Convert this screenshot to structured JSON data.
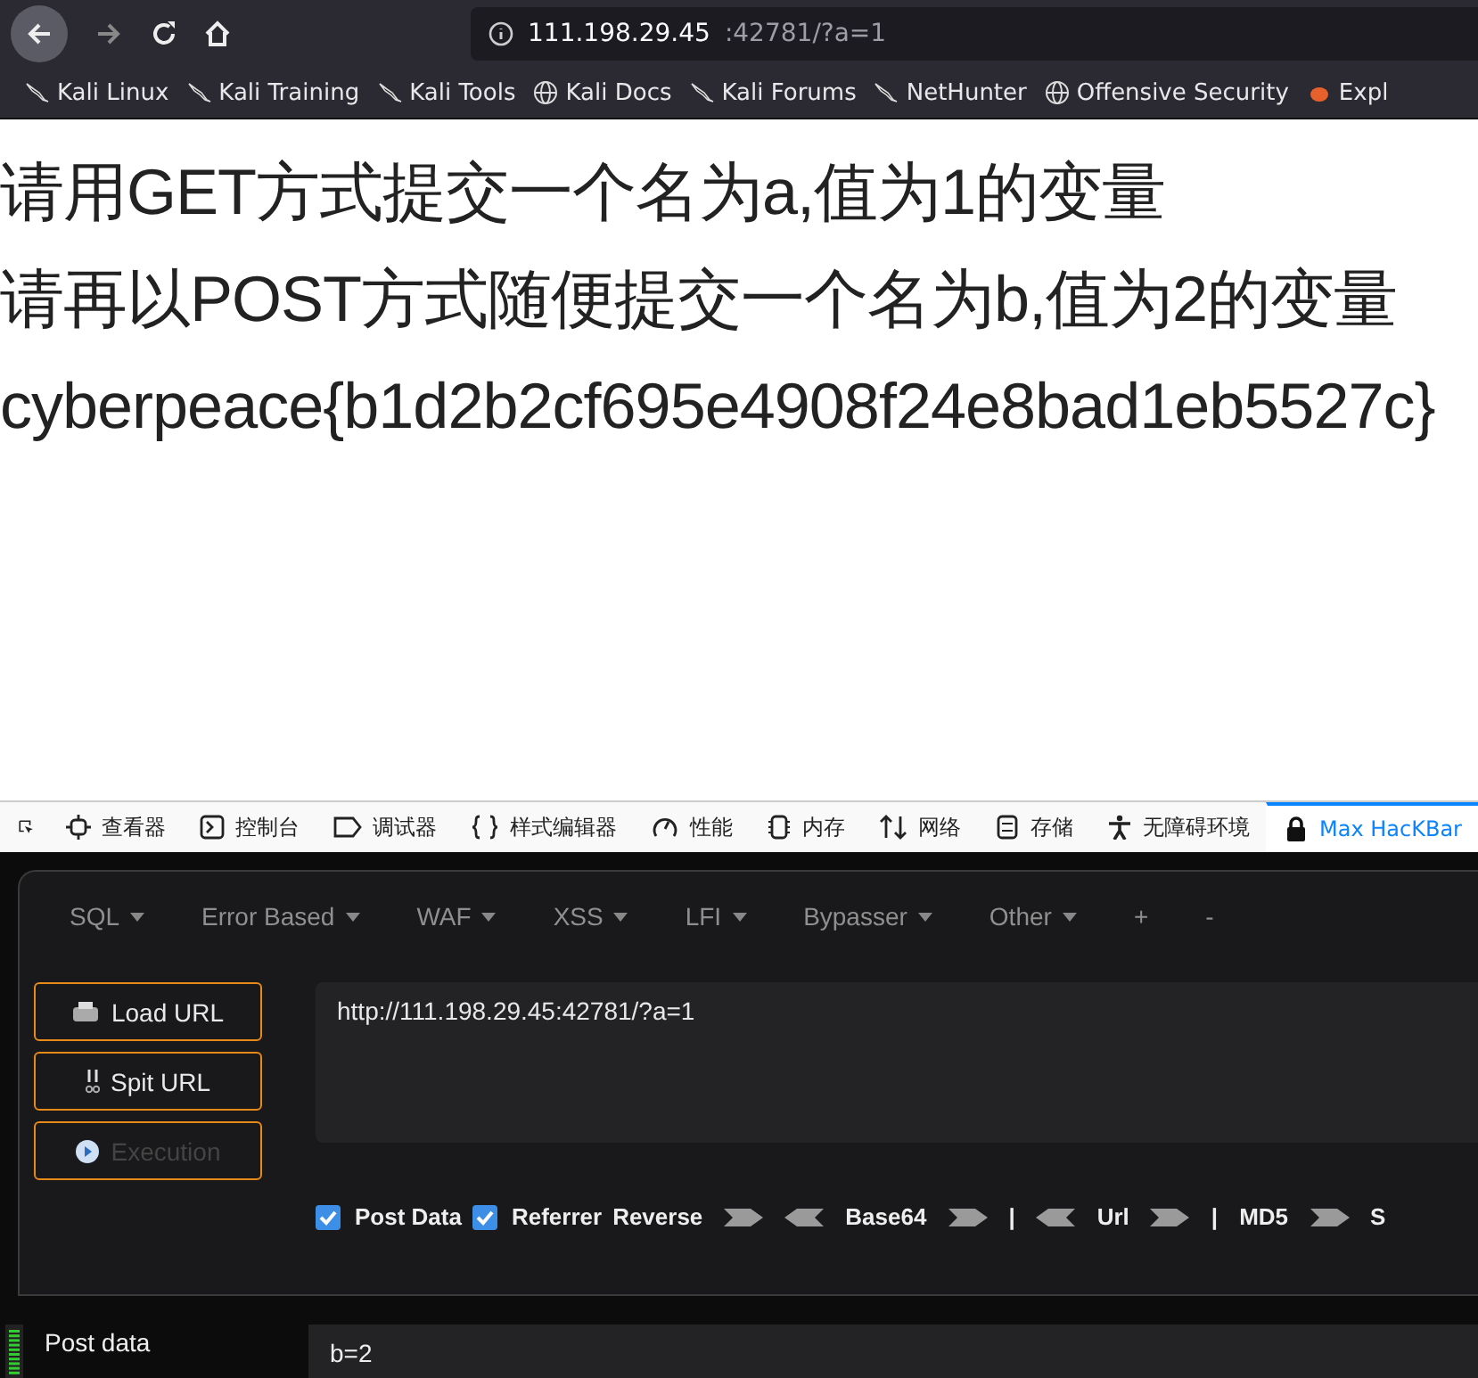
{
  "toolbar": {
    "url_host": "111.198.29.45",
    "url_rest": ":42781/?a=1"
  },
  "bookmarks": [
    {
      "label": "Kali Linux",
      "kind": "kali"
    },
    {
      "label": "Kali Training",
      "kind": "kali"
    },
    {
      "label": "Kali Tools",
      "kind": "kali"
    },
    {
      "label": "Kali Docs",
      "kind": "globe"
    },
    {
      "label": "Kali Forums",
      "kind": "kali"
    },
    {
      "label": "NetHunter",
      "kind": "kali"
    },
    {
      "label": "Offensive Security",
      "kind": "globe"
    },
    {
      "label": "Expl",
      "kind": "bug"
    }
  ],
  "content": {
    "lines": [
      "请用GET方式提交一个名为a,值为1的变量",
      "请再以POST方式随便提交一个名为b,值为2的变量",
      "cyberpeace{b1d2b2cf695e4908f24e8bad1eb5527c}"
    ]
  },
  "devtools_tabs": [
    {
      "label": "查看器",
      "kind": "inspector",
      "selected": false
    },
    {
      "label": "控制台",
      "kind": "console",
      "selected": false
    },
    {
      "label": "调试器",
      "kind": "debugger",
      "selected": false
    },
    {
      "label": "样式编辑器",
      "kind": "style",
      "selected": false
    },
    {
      "label": "性能",
      "kind": "perf",
      "selected": false
    },
    {
      "label": "内存",
      "kind": "memory",
      "selected": false
    },
    {
      "label": "网络",
      "kind": "network",
      "selected": false
    },
    {
      "label": "存储",
      "kind": "storage",
      "selected": false
    },
    {
      "label": "无障碍环境",
      "kind": "a11y",
      "selected": false
    },
    {
      "label": "Max HacKBar",
      "kind": "hackbar",
      "selected": true
    }
  ],
  "hackbar": {
    "menus": [
      {
        "label": "SQL",
        "dropdown": true
      },
      {
        "label": "Error Based",
        "dropdown": true
      },
      {
        "label": "WAF",
        "dropdown": true
      },
      {
        "label": "XSS",
        "dropdown": true
      },
      {
        "label": "LFI",
        "dropdown": true
      },
      {
        "label": "Bypasser",
        "dropdown": true
      },
      {
        "label": "Other",
        "dropdown": true
      },
      {
        "label": "+",
        "dropdown": false
      },
      {
        "label": "-",
        "dropdown": false
      }
    ],
    "buttons": [
      {
        "label": "Load URL",
        "kind": "load",
        "disabled": false
      },
      {
        "label": "Spit URL",
        "kind": "split",
        "disabled": false
      },
      {
        "label": "Execution",
        "kind": "exec",
        "disabled": true
      }
    ],
    "url_value": "http://111.198.29.45:42781/?a=1",
    "options": [
      {
        "kind": "checkbox",
        "label": "Post Data",
        "checked": true
      },
      {
        "kind": "checkbox",
        "label": "Referrer",
        "checked": true
      },
      {
        "kind": "label",
        "label": "Reverse"
      },
      {
        "kind": "right"
      },
      {
        "kind": "left"
      },
      {
        "kind": "label",
        "label": "Base64"
      },
      {
        "kind": "right"
      },
      {
        "kind": "sep",
        "label": "|"
      },
      {
        "kind": "left"
      },
      {
        "kind": "label",
        "label": "Url"
      },
      {
        "kind": "right"
      },
      {
        "kind": "sep",
        "label": "|"
      },
      {
        "kind": "label",
        "label": "MD5"
      },
      {
        "kind": "right"
      },
      {
        "kind": "label",
        "label": "S"
      }
    ],
    "post_label": "Post data",
    "post_value": "b=2"
  }
}
